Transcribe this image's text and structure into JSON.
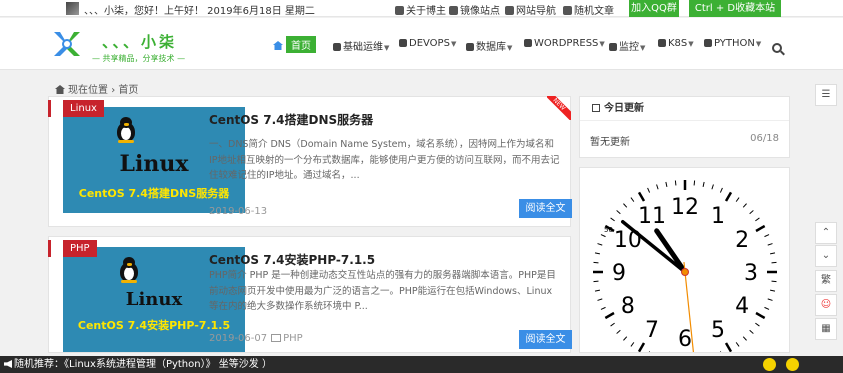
{
  "topbar": {
    "greeting": "、、、小柒，您好！上午好！ 2019年6月18日 星期二",
    "links": [
      {
        "label": "关于博主",
        "icon": "user-icon"
      },
      {
        "label": "镜像站点",
        "icon": "image-icon"
      },
      {
        "label": "网站导航",
        "icon": "sitemap-icon"
      },
      {
        "label": "随机文章",
        "icon": "shuffle-icon"
      }
    ],
    "join_qq": "加入QQ群",
    "bookmark": "Ctrl + D收藏本站"
  },
  "header": {
    "site_name": "、、、小柒",
    "slogan": "— 共享精品，分享技术 —",
    "nav": [
      {
        "label": "首页",
        "icon": "home-icon"
      },
      {
        "label": "基础运维",
        "icon": "gears-icon"
      },
      {
        "label": "DEVOPS",
        "icon": "cloud-icon"
      },
      {
        "label": "数据库",
        "icon": "database-icon"
      },
      {
        "label": "WORDPRESS",
        "icon": "wordpress-icon"
      },
      {
        "label": "监控",
        "icon": "chart-icon"
      },
      {
        "label": "K8S",
        "icon": "cube-icon"
      },
      {
        "label": "PYTHON",
        "icon": "python-icon"
      }
    ]
  },
  "breadcrumb": {
    "prefix": "现在位置",
    "separator": "›",
    "current": "首页"
  },
  "posts": [
    {
      "category": "Linux",
      "title": "CentOS 7.4搭建DNS服务器",
      "thumb_word": "Linux",
      "thumb_title": "CentOS 7.4搭建DNS服务器",
      "excerpt": "一、DNS简介 DNS（Domain Name System，域名系统），因特网上作为域名和IP地址相互映射的一个分布式数据库，能够使用户更方便的访问互联网，而不用去记住较难记住的IP地址。通过域名，...",
      "date": "2019-06-13",
      "folder": "",
      "read_more": "阅读全文",
      "ribbon": "NEW"
    },
    {
      "category": "PHP",
      "title": "CentOS 7.4安装PHP-7.1.5",
      "thumb_word": "Linux",
      "thumb_title": "CentOS 7.4安装PHP-7.1.5",
      "excerpt": "PHP简介 PHP 是一种创建动态交互性站点的强有力的服务器端脚本语言。PHP是目前动态网页开发中使用最为广泛的语言之一。PHP能运行在包括Windows、Linux等在内的绝大多数操作系统环境中 P...",
      "date": "2019-06-07",
      "folder": "PHP",
      "read_more": "阅读全文",
      "ribbon": ""
    }
  ],
  "sidebar": {
    "updates_title": "今日更新",
    "updates_text": "暂无更新",
    "updates_count": "06/18",
    "clock": {
      "hour": 10,
      "minute": 51,
      "second": 29,
      "numerals": [
        "12",
        "1",
        "2",
        "3",
        "4",
        "5",
        "6",
        "7",
        "8",
        "9",
        "10",
        "11"
      ],
      "minute_marks": [
        "50"
      ]
    }
  },
  "float_buttons": [
    {
      "label": "☰",
      "icon": "menu-icon"
    },
    {
      "label": "⌃",
      "icon": "chevron-up-icon"
    },
    {
      "label": "⌄",
      "icon": "chevron-down-icon"
    },
    {
      "label": "繁",
      "icon": "traditional-chinese-icon"
    },
    {
      "label": "☺",
      "icon": "qq-icon"
    },
    {
      "label": "▦",
      "icon": "qrcode-icon"
    }
  ],
  "bottombar": {
    "text": "随机推荐：《Linux系统进程管理（Python）》 坐等沙发 ）"
  },
  "colors": {
    "green": "#3cb034",
    "blue": "#3a8ee6",
    "red": "#c7232c",
    "thumb": "#2e8ab3"
  }
}
